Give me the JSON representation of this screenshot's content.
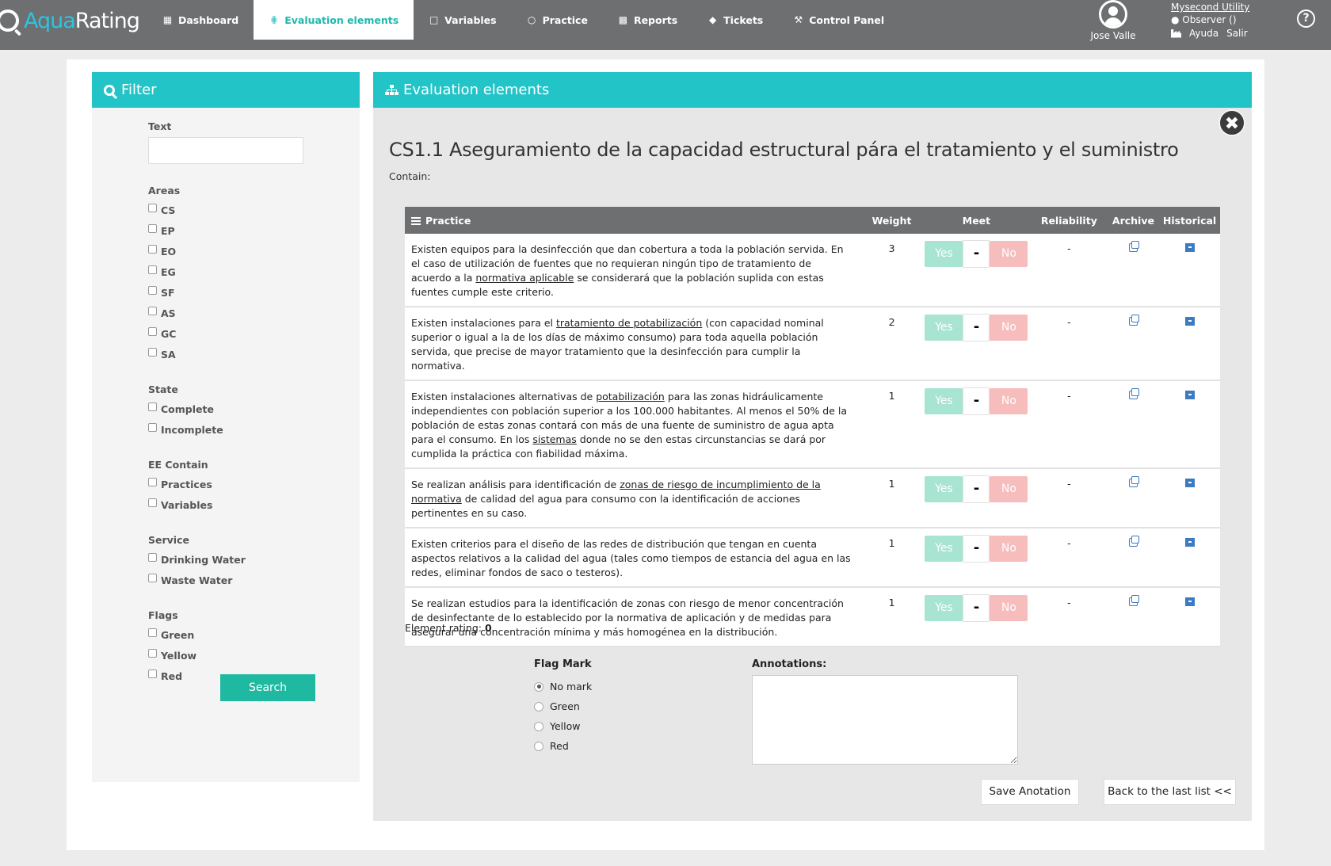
{
  "app": {
    "logo_aqua": "Aqua",
    "logo_rating": "Rating"
  },
  "nav": {
    "items": [
      {
        "label": "Dashboard",
        "icon": "grid-icon"
      },
      {
        "label": "Evaluation elements",
        "icon": "sitemap-icon",
        "active": true
      },
      {
        "label": "Variables",
        "icon": "square-icon"
      },
      {
        "label": "Practice",
        "icon": "circle-icon"
      },
      {
        "label": "Reports",
        "icon": "bar-chart-icon"
      },
      {
        "label": "Tickets",
        "icon": "tag-icon"
      },
      {
        "label": "Control Panel",
        "icon": "wrench-icon"
      }
    ]
  },
  "user": {
    "name": "Jose Valle",
    "utility": "Mysecond Utility",
    "role": "● Observer ()",
    "help_label": "Ayuda",
    "logout_label": "Salir"
  },
  "filter": {
    "title": "Filter",
    "text_label": "Text",
    "areas_label": "Areas",
    "areas": [
      "CS",
      "EP",
      "EO",
      "EG",
      "SF",
      "AS",
      "GC",
      "SA"
    ],
    "state_label": "State",
    "state": [
      "Complete",
      "Incomplete"
    ],
    "ee_contain_label": "EE Contain",
    "ee_contain": [
      "Practices",
      "Variables"
    ],
    "service_label": "Service",
    "service": [
      "Drinking Water",
      "Waste Water"
    ],
    "flags_label": "Flags",
    "flags": [
      "Green",
      "Yellow",
      "Red"
    ],
    "search_label": "Search"
  },
  "main": {
    "panel_title": "Evaluation elements",
    "ee_title": "CS1.1 Aseguramiento de la capacidad estructural pára el tratamiento y el suministro",
    "contain_label": "Contain:",
    "columns": {
      "practice": "Practice",
      "weight": "Weight",
      "meet": "Meet",
      "reliability": "Reliability",
      "archive": "Archive",
      "historical": "Historical"
    },
    "meet_yes": "Yes",
    "meet_dash": "-",
    "meet_no": "No",
    "rows": [
      {
        "weight": "3",
        "reliability": "-",
        "parts": [
          {
            "t": "Existen equipos para la desinfección que dan cobertura a toda la población servida. En el caso de utilización de fuentes que no requieran ningún tipo de tratamiento de acuerdo a la "
          },
          {
            "t": "normativa aplicable",
            "u": true
          },
          {
            "t": " se considerará que la población suplida con estas fuentes cumple este criterio."
          }
        ]
      },
      {
        "weight": "2",
        "reliability": "-",
        "parts": [
          {
            "t": "Existen instalaciones para el "
          },
          {
            "t": "tratamiento de potabilización",
            "u": true
          },
          {
            "t": " (con capacidad nominal superior o igual a la de los días de máximo consumo) para toda aquella población servida, que precise de mayor tratamiento que la desinfección para cumplir la normativa."
          }
        ]
      },
      {
        "weight": "1",
        "reliability": "-",
        "parts": [
          {
            "t": "Existen instalaciones alternativas de "
          },
          {
            "t": "potabilización",
            "u": true
          },
          {
            "t": " para las zonas hidráulicamente independientes con población superior a los 100.000 habitantes. Al menos el 50% de la población de estas zonas contará con más de una fuente de suministro de agua apta para el consumo. En los "
          },
          {
            "t": "sistemas",
            "u": true
          },
          {
            "t": " donde no se den estas circunstancias se dará por cumplida la práctica con fiabilidad máxima."
          }
        ]
      },
      {
        "weight": "1",
        "reliability": "-",
        "parts": [
          {
            "t": "Se realizan análisis para identificación de "
          },
          {
            "t": "zonas de riesgo de incumplimiento de la normativa",
            "u": true
          },
          {
            "t": " de calidad del agua para consumo con la identificación de acciones pertinentes en su caso."
          }
        ]
      },
      {
        "weight": "1",
        "reliability": "-",
        "parts": [
          {
            "t": "Existen criterios para el diseño de las redes de distribución que tengan en cuenta aspectos relativos a la calidad del agua (tales como tiempos de estancia del agua en las redes, eliminar fondos de saco o testeros)."
          }
        ]
      },
      {
        "weight": "1",
        "reliability": "-",
        "parts": [
          {
            "t": "Se realizan estudios para la identificación de zonas con riesgo de menor concentración de desinfectante de lo establecido por la normativa de aplicación y de medidas para asegurar una concentración mínima y más homogénea en la distribución."
          }
        ]
      }
    ],
    "rating_label": "Element rating:",
    "rating_value": "0",
    "flag_mark_label": "Flag Mark",
    "flag_options": [
      "No mark",
      "Green",
      "Yellow",
      "Red"
    ],
    "flag_selected": 0,
    "annotations_label": "Annotations:",
    "annotations_value": "",
    "save_label": "Save Anotation",
    "back_label": "Back to the last list <<"
  },
  "colors": {
    "accent": "#23c4c8",
    "nav_bg": "#6e6f71",
    "yes": "#a8e4d2",
    "no": "#f7bcbc",
    "search_btn": "#1fb8a0"
  }
}
